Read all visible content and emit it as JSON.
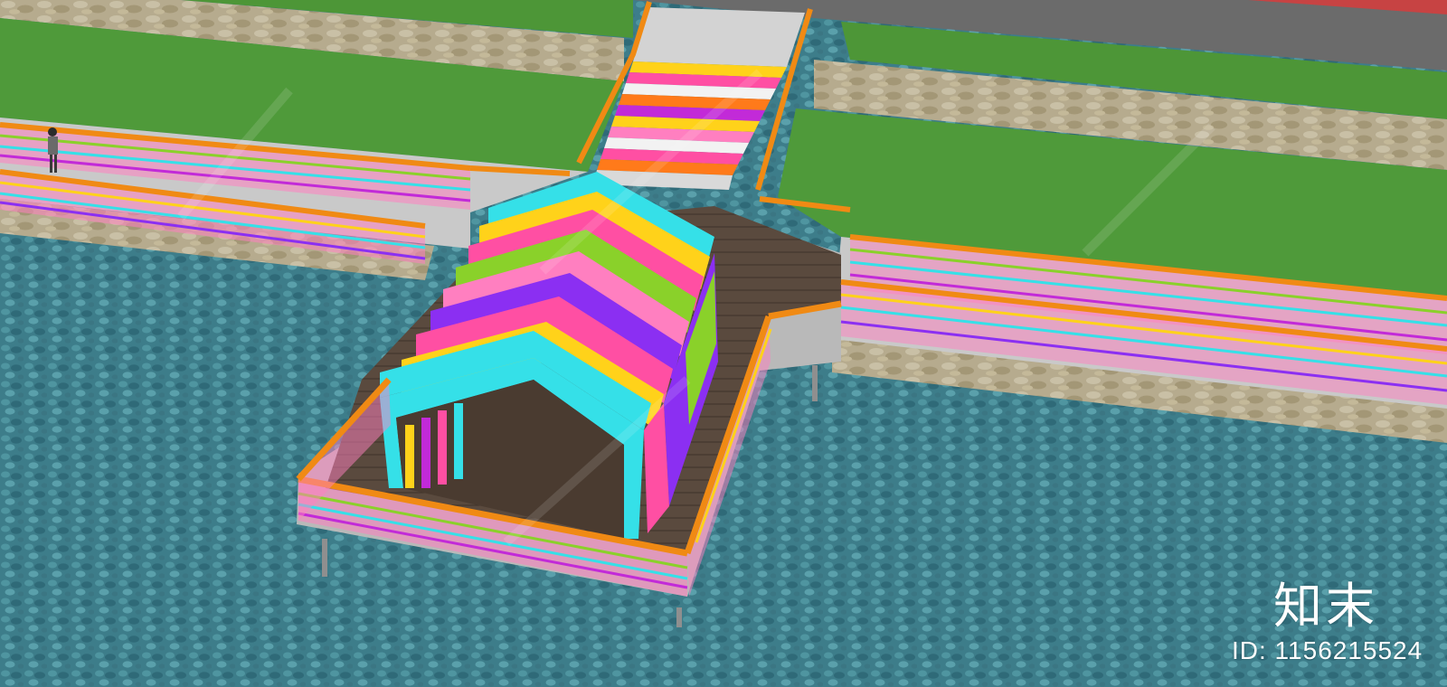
{
  "scene": {
    "subject": "rainbow-waterfront-pavilion-render",
    "palette": {
      "water": "#3f7f8c",
      "grass": "#4f9a3a",
      "stone": "#b8ae94",
      "road": "#6c6c6c",
      "deck": "#5b4a3e",
      "railing_top": "#f08a14",
      "stairs_top": "#d6d6d6"
    },
    "rainbow": [
      "#ff4fa3",
      "#ffd21a",
      "#8ad12a",
      "#35e0e8",
      "#8b2ff2",
      "#ff7a1a",
      "#c22ad8"
    ]
  },
  "watermark": {
    "logo": "知末",
    "id_text": "ID: 1156215524"
  }
}
